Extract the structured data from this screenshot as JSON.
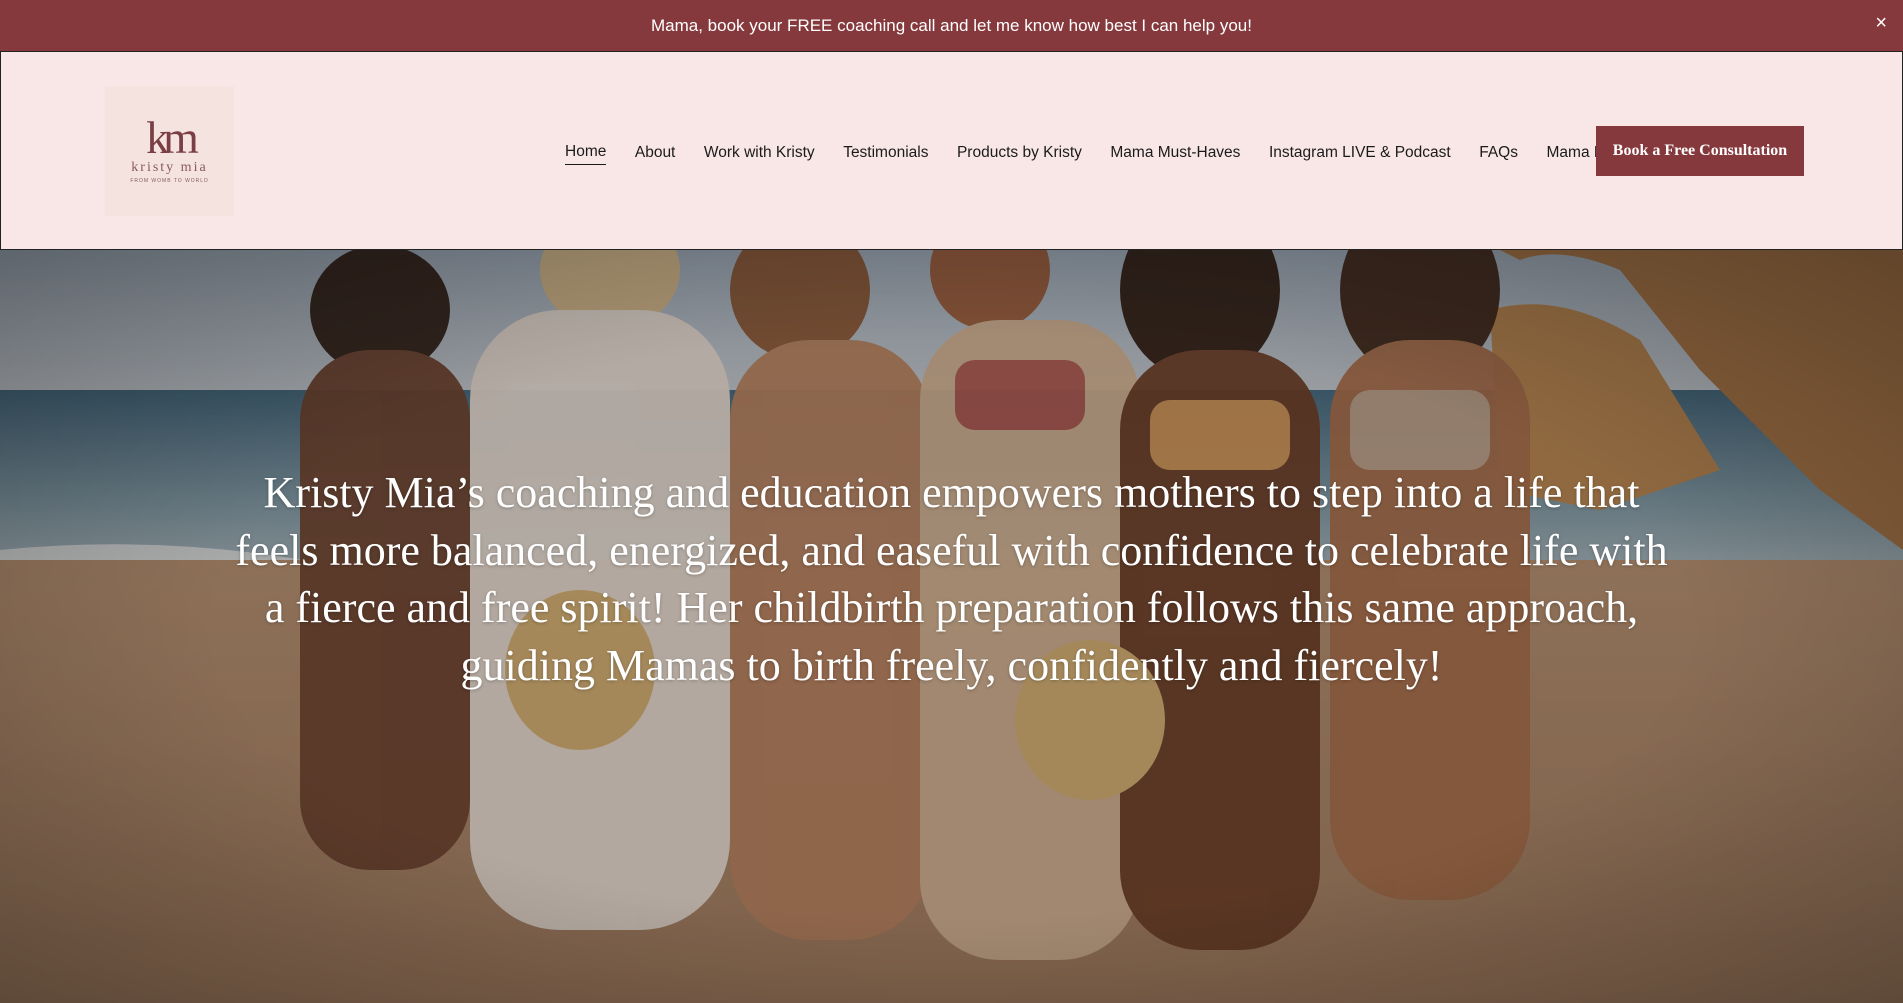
{
  "announcement": {
    "text": "Mama, book your FREE coaching call and let me know how best I can help you!",
    "close_label": "×"
  },
  "logo": {
    "monogram": "km",
    "name": "kristy mia",
    "tagline": "FROM WOMB TO WORLD"
  },
  "nav": {
    "items": [
      {
        "label": "Home",
        "active": true
      },
      {
        "label": "About"
      },
      {
        "label": "Work with Kristy"
      },
      {
        "label": "Testimonials"
      },
      {
        "label": "Products by Kristy"
      },
      {
        "label": "Mama Must-Haves"
      },
      {
        "label": "Instagram LIVE & Podcast"
      },
      {
        "label": "FAQs"
      },
      {
        "label": "Mama Blog"
      }
    ],
    "cta_label": "Book a Free Consultation"
  },
  "hero": {
    "headline": "Kristy Mia’s coaching and education empowers mothers to step into a life that feels more balanced, energized, and easeful with confidence to celebrate life with a fierce and free spirit! Her childbirth preparation follows this same approach, guiding Mamas to birth freely, confidently and fiercely!",
    "image_description_icon": "beach-group-photo"
  },
  "colors": {
    "brand": "#86393d",
    "header_bg": "#f8e7e6"
  }
}
